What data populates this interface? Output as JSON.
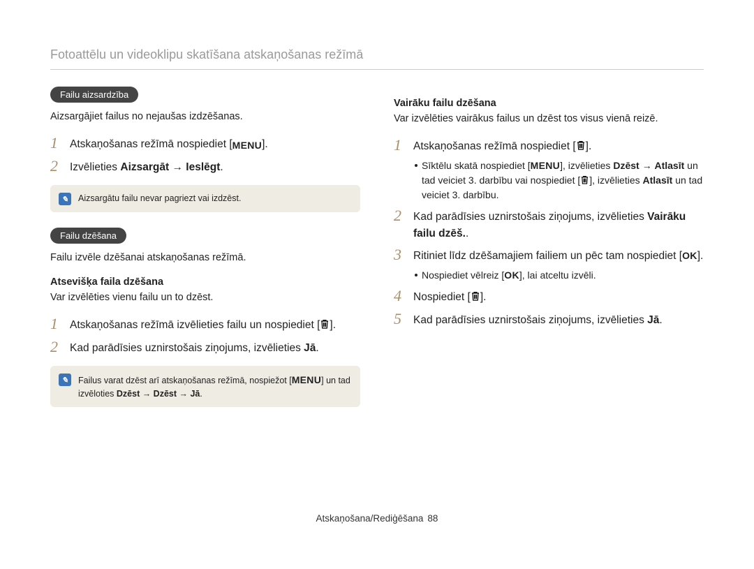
{
  "header": {
    "title": "Fotoattēlu un videoklipu skatīšana atskaņošanas režīmā"
  },
  "icons": {
    "menu": "MENU",
    "ok": "OK"
  },
  "left": {
    "section1": {
      "pill": "Failu aizsardzība",
      "body": "Aizsargājiet failus no nejaušas izdzēšanas.",
      "step1_pre": "Atskaņošanas režīmā nospiediet [",
      "step1_post": "].",
      "step2_pre": "Izvēlieties ",
      "step2_b1": "Aizsargāt",
      "step2_arrow": " → ",
      "step2_b2": "Ieslēgt",
      "step2_post": ".",
      "note": "Aizsargātu failu nevar pagriezt vai izdzēst."
    },
    "section2": {
      "pill": "Failu dzēšana",
      "body": "Failu izvēle dzēšanai atskaņošanas režīmā.",
      "sub1": "Atsevišķa faila dzēšana",
      "sub1body": "Var izvēlēties vienu failu un to dzēst.",
      "s1_pre": "Atskaņošanas režīmā izvēlieties failu un nospiediet [",
      "s1_post": "].",
      "s2_pre": "Kad parādīsies uznirstošais ziņojums, izvēlieties ",
      "s2_b": "Jā",
      "s2_post": ".",
      "note_pre": "Failus varat dzēst arī atskaņošanas režīmā, nospiežot [",
      "note_mid": "] un tad izvēloties ",
      "note_seq": "Dzēst → Dzēst → Jā",
      "note_post": "."
    }
  },
  "right": {
    "sub": "Vairāku failu dzēšana",
    "subbody": "Var izvēlēties vairākus failus un dzēst tos visus vienā reizē.",
    "s1_pre": "Atskaņošanas režīmā nospiediet [",
    "s1_post": "].",
    "sub1_pre": "Sīktēlu skatā nospiediet [",
    "sub1_mid1": "], izvēlieties ",
    "sub1_b1": "Dzēst",
    "sub1_arrow": " → ",
    "sub1_b2": "Atlasīt",
    "sub1_mid2": " un tad veiciet 3. darbību vai nospiediet [",
    "sub1_mid3": "], izvēlieties ",
    "sub1_b3": "Atlasīt",
    "sub1_end": " un tad veiciet 3. darbību.",
    "s2_pre": "Kad parādīsies uznirstošais ziņojums, izvēlieties ",
    "s2_b": "Vairāku failu dzēš.",
    "s2_post": ".",
    "s3_pre": "Ritiniet līdz dzēšamajiem failiem un pēc tam nospiediet [",
    "s3_post": "].",
    "s3sub_pre": "Nospiediet vēlreiz [",
    "s3sub_post": "], lai atceltu izvēli.",
    "s4_pre": "Nospiediet [",
    "s4_post": "].",
    "s5_pre": "Kad parādīsies uznirstošais ziņojums, izvēlieties ",
    "s5_b": "Jā",
    "s5_post": "."
  },
  "footer": {
    "label": "Atskaņošana/Rediģēšana",
    "page": "88"
  }
}
